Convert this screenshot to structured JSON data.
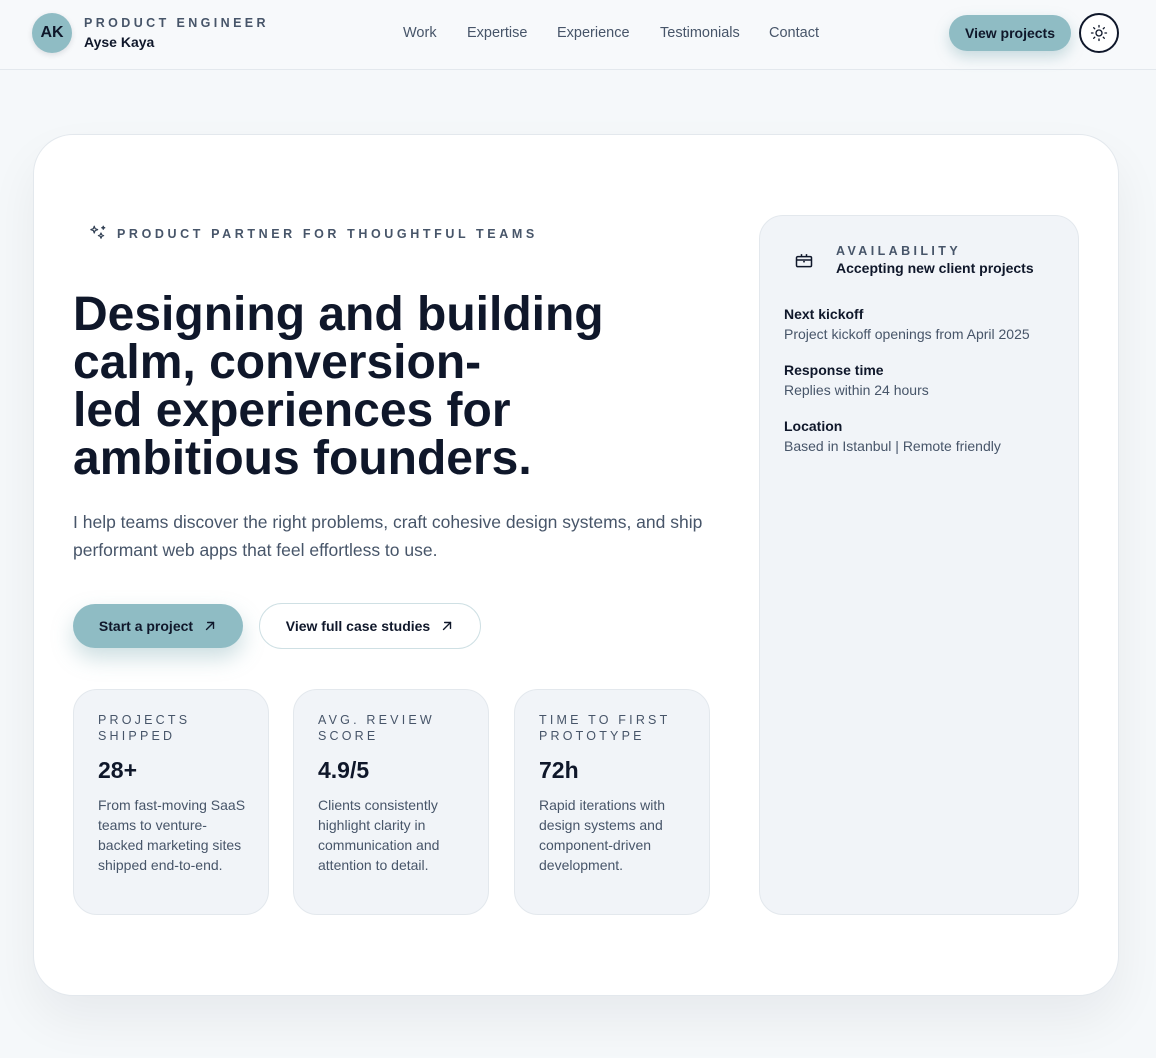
{
  "header": {
    "avatar_initials": "AK",
    "role": "PRODUCT ENGINEER",
    "name": "Ayse Kaya",
    "nav": [
      "Work",
      "Expertise",
      "Experience",
      "Testimonials",
      "Contact"
    ],
    "cta_label": "View projects",
    "theme_toggle_icon": "sun-icon"
  },
  "hero": {
    "eyebrow": "PRODUCT PARTNER FOR THOUGHTFUL TEAMS",
    "eyebrow_icon": "sparkles-icon",
    "headline_lines": [
      "Designing and building",
      "calm, conversion-",
      "led experiences for",
      "ambitious founders."
    ],
    "intro": "I help teams discover the right problems, craft cohesive design systems, and ship performant web apps that feel effortless to use.",
    "primary_cta": "Start a project",
    "secondary_cta": "View full case studies",
    "cta_icon": "arrow-up-right-icon"
  },
  "stats": [
    {
      "label": "PROJECTS SHIPPED",
      "value": "28+",
      "description": "From fast-moving SaaS teams to venture-backed marketing sites shipped end-to-end."
    },
    {
      "label": "AVG. REVIEW SCORE",
      "value": "4.9/5",
      "description": "Clients consistently highlight clarity in communication and attention to detail."
    },
    {
      "label": "TIME TO FIRST PROTOTYPE",
      "value": "72h",
      "description": "Rapid iterations with design systems and component-driven development."
    }
  ],
  "availability": {
    "label": "AVAILABILITY",
    "status": "Accepting new client projects",
    "icon": "briefcase-icon",
    "items": [
      {
        "title": "Next kickoff",
        "value": "Project kickoff openings from April 2025"
      },
      {
        "title": "Response time",
        "value": "Replies within 24 hours"
      },
      {
        "title": "Location",
        "value": "Based in Istanbul | Remote friendly"
      }
    ]
  },
  "colors": {
    "accent": "#8fbcc4",
    "text_primary": "#0f172a",
    "text_muted": "#475569",
    "page_background": "#f5f8fa",
    "panel_background": "#f1f4f8"
  }
}
